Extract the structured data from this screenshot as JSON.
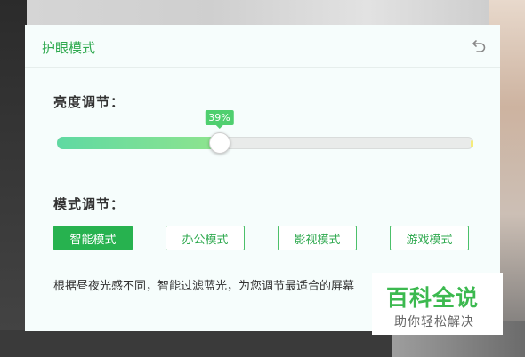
{
  "panel": {
    "title": "护眼模式"
  },
  "brightness": {
    "label": "亮度调节：",
    "value_percent": 39,
    "value_text": "39%"
  },
  "mode": {
    "label": "模式调节：",
    "buttons": [
      {
        "label": "智能模式",
        "active": true
      },
      {
        "label": "办公模式",
        "active": false
      },
      {
        "label": "影视模式",
        "active": false
      },
      {
        "label": "游戏模式",
        "active": false
      }
    ],
    "description": "根据昼夜光感不同，智能过滤蓝光，为您调节最适合的屏幕"
  },
  "watermark": {
    "title": "百科全说",
    "subtitle": "助你轻松解决"
  },
  "colors": {
    "accent": "#27b24f",
    "accent_text": "#2fa94f",
    "panel_bg": "#f6fdfc",
    "slider_fill_start": "#5fd9a2",
    "slider_fill_end": "#8fe48e"
  },
  "icons": {
    "undo": "undo-icon"
  }
}
